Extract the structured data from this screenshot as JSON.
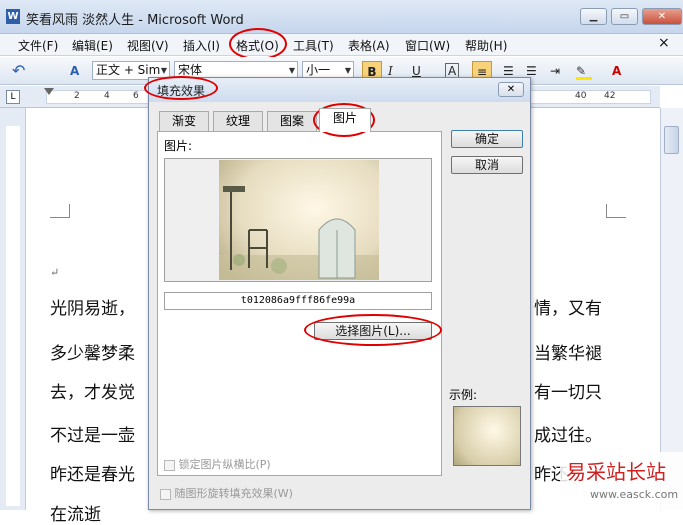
{
  "window": {
    "title": "笑看风雨 淡然人生 - Microsoft Word",
    "app_icon": "W"
  },
  "menu": {
    "items": [
      "文件(F)",
      "编辑(E)",
      "视图(V)",
      "插入(I)",
      "格式(O)",
      "工具(T)",
      "表格(A)",
      "窗口(W)",
      "帮助(H)"
    ],
    "close_glyph": "×"
  },
  "toolbar": {
    "style": "正文 + Sim",
    "font": "宋体",
    "size": "小一",
    "bold": "B",
    "italic": "I",
    "underline": "U",
    "char_border": "A",
    "font_color": "A"
  },
  "ruler": {
    "numbers": [
      "2",
      "4",
      "6",
      "40",
      "42"
    ]
  },
  "document": {
    "paragraph_mark": "↵",
    "lines": [
      "光阴易逝，",
      "多少馨梦柔",
      "去，才发觉",
      "不过是一壶",
      "昨还是春光",
      "在流逝"
    ],
    "right_lines": [
      "情，又有",
      "当繁华褪",
      "有一切只",
      "成过往。",
      "昨还"
    ]
  },
  "dialog": {
    "title": "填充效果",
    "close_glyph": "✕",
    "tabs": [
      "渐变",
      "纹理",
      "图案",
      "图片"
    ],
    "active_tab": "图片",
    "picture_label": "图片:",
    "filename": "t012086a9fff86fe99a",
    "select_button": "选择图片(L)...",
    "lock_aspect": "锁定图片纵横比(P)",
    "rotate_with_shape": "随图形旋转填充效果(W)",
    "ok": "确定",
    "cancel": "取消",
    "sample_label": "示例:"
  },
  "watermark": {
    "text": "易采站长站",
    "url": "www.easck.com"
  },
  "colors": {
    "accent_red": "#e00000",
    "title_blue": "#c6d6ec"
  }
}
